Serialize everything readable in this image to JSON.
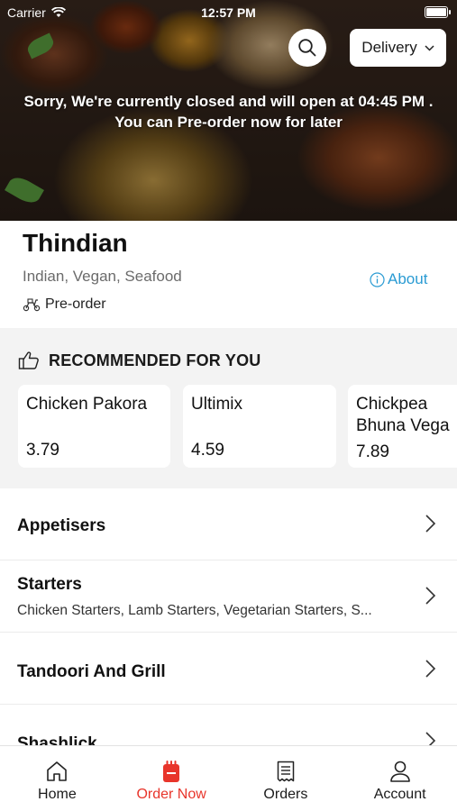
{
  "statusbar": {
    "carrier": "Carrier",
    "time": "12:57 PM"
  },
  "hero": {
    "delivery_label": "Delivery",
    "closed_message_line1": "Sorry, We're currently closed and will open at 04:45 PM .",
    "closed_message_line2": "You can Pre-order now for later"
  },
  "restaurant": {
    "name": "Thindian",
    "cuisine": "Indian, Vegan, Seafood",
    "about_label": "About",
    "preorder_label": "Pre-order"
  },
  "recommended": {
    "heading": "RECOMMENDED FOR YOU",
    "items": [
      {
        "name": "Chicken Pakora",
        "price": "3.79"
      },
      {
        "name": "Ultimix",
        "price": "4.59"
      },
      {
        "name": "Chickpea Bhuna Vega",
        "name_line1": "Chickpea",
        "name_line2": "Bhuna Vega",
        "price": "7.89"
      }
    ]
  },
  "categories": [
    {
      "title": "Appetisers",
      "subtitle": ""
    },
    {
      "title": "Starters",
      "subtitle": "Chicken Starters, Lamb Starters, Vegetarian Starters, S..."
    },
    {
      "title": "Tandoori And Grill",
      "subtitle": ""
    },
    {
      "title": "Shashlick",
      "subtitle": ""
    }
  ],
  "tabbar": {
    "tabs": [
      {
        "label": "Home",
        "icon": "home-icon"
      },
      {
        "label": "Order Now",
        "icon": "order-bag-icon",
        "active": true
      },
      {
        "label": "Orders",
        "icon": "receipt-icon"
      },
      {
        "label": "Account",
        "icon": "user-icon"
      }
    ]
  },
  "colors": {
    "accent": "#e8352b",
    "link": "#2a9bd3"
  }
}
